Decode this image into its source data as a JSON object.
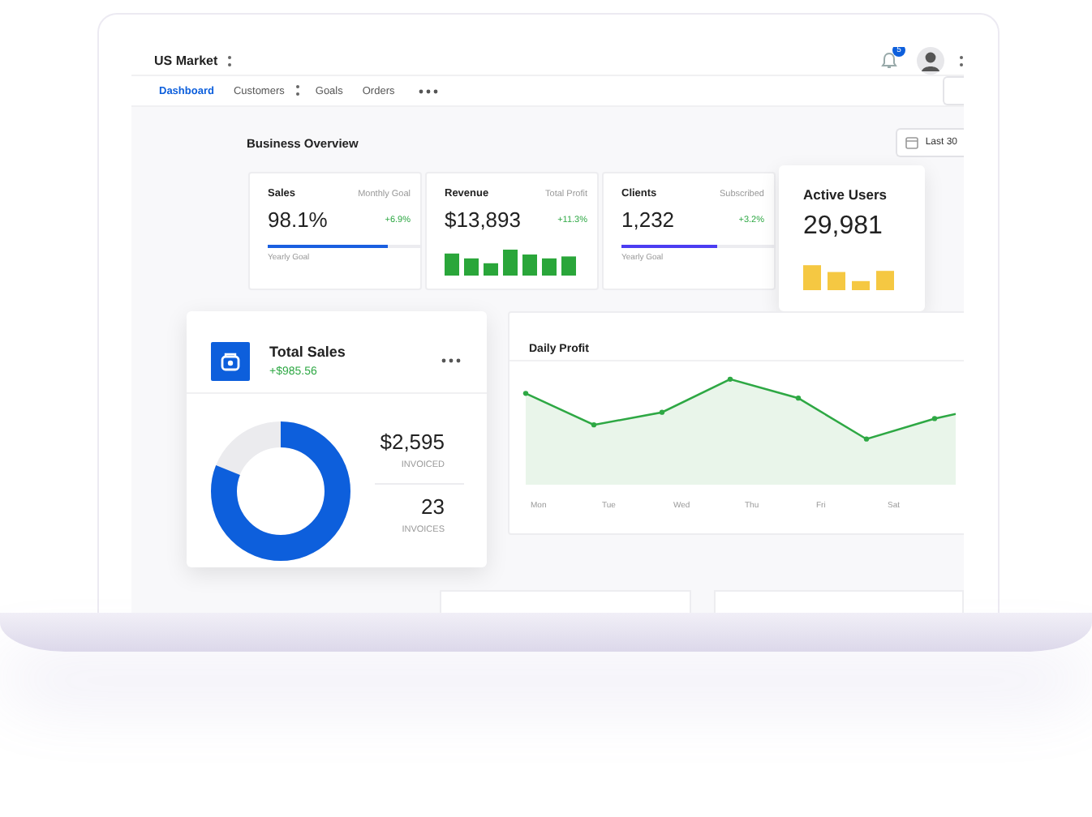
{
  "header": {
    "market": "US Market",
    "notification_count": "5"
  },
  "nav": {
    "tabs": [
      {
        "label": "Dashboard",
        "selected": true,
        "has_menu": false
      },
      {
        "label": "Customers",
        "selected": false,
        "has_menu": true
      },
      {
        "label": "Goals",
        "selected": false,
        "has_menu": false
      },
      {
        "label": "Orders",
        "selected": false,
        "has_menu": false
      }
    ]
  },
  "overview": {
    "title": "Business Overview",
    "date_button": "Last 30",
    "cards": [
      {
        "kind": "progress",
        "title": "Sales",
        "subtitle": "Monthly Goal",
        "value": "98.1%",
        "change": "+6.9%",
        "level": 0.78,
        "footer": "Yearly Goal",
        "color": "#1a5fe0"
      },
      {
        "kind": "bars",
        "title": "Revenue",
        "subtitle": "Total Profit",
        "value": "$13,893",
        "change": "+11.3%",
        "color": "#2aa63a"
      },
      {
        "kind": "progress",
        "title": "Clients",
        "subtitle": "Subscribed",
        "value": "1,232",
        "change": "+3.2%",
        "level": 0.62,
        "footer": "Yearly Goal",
        "color": "#4b3cf2"
      }
    ],
    "active_users": {
      "title": "Active Users",
      "value": "29,981"
    }
  },
  "total_sales": {
    "title": "Total Sales",
    "change": "+$985.56",
    "stats": [
      {
        "value": "$2,595",
        "label": "INVOICED"
      },
      {
        "value": "23",
        "label": "INVOICES"
      }
    ]
  },
  "daily_profit": {
    "title": "Daily Profit",
    "days": [
      "Mon",
      "Tue",
      "Wed",
      "Thu",
      "Fri",
      "Sat"
    ]
  }
}
